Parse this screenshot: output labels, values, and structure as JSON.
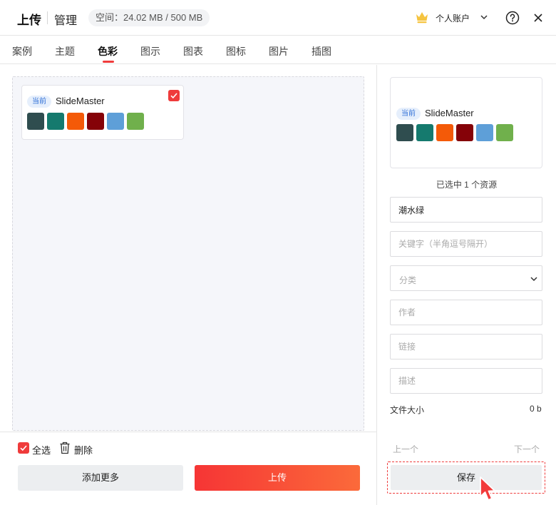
{
  "header": {
    "upload_title": "上传",
    "manage_title": "管理",
    "space": "空间：24.02 MB / 500 MB",
    "account_label": "个人账户"
  },
  "tabs": [
    {
      "label": "案例",
      "active": false
    },
    {
      "label": "主题",
      "active": false
    },
    {
      "label": "色彩",
      "active": true
    },
    {
      "label": "图示",
      "active": false
    },
    {
      "label": "图表",
      "active": false
    },
    {
      "label": "图标",
      "active": false
    },
    {
      "label": "图片",
      "active": false
    },
    {
      "label": "插图",
      "active": false
    }
  ],
  "card": {
    "badge": "当前",
    "name": "SlideMaster",
    "checked": true,
    "colors": [
      "#2f4d4f",
      "#157a6e",
      "#f45a08",
      "#850208",
      "#5e9fd8",
      "#70b04c"
    ]
  },
  "bottom": {
    "select_all": "全选",
    "delete": "删除",
    "add_more": "添加更多",
    "upload": "上传"
  },
  "right": {
    "preview": {
      "badge": "当前",
      "name": "SlideMaster",
      "colors": [
        "#2f4d4f",
        "#157a6e",
        "#f45a08",
        "#850208",
        "#5e9fd8",
        "#70b04c"
      ]
    },
    "selected_info": "已选中 1 个资源",
    "name_value": "潮水绿",
    "keywords_placeholder": "关键字（半角逗号隔开）",
    "category_placeholder": "分类",
    "author_placeholder": "作者",
    "link_placeholder": "链接",
    "desc_placeholder": "描述",
    "file_size_label": "文件大小",
    "file_size_value": "0 b",
    "prev": "上一个",
    "next": "下一个",
    "save": "保存"
  },
  "colors": {
    "accent": "#ef3b3b",
    "badge_bg": "#e6effc",
    "badge_text": "#2f6fd6"
  }
}
